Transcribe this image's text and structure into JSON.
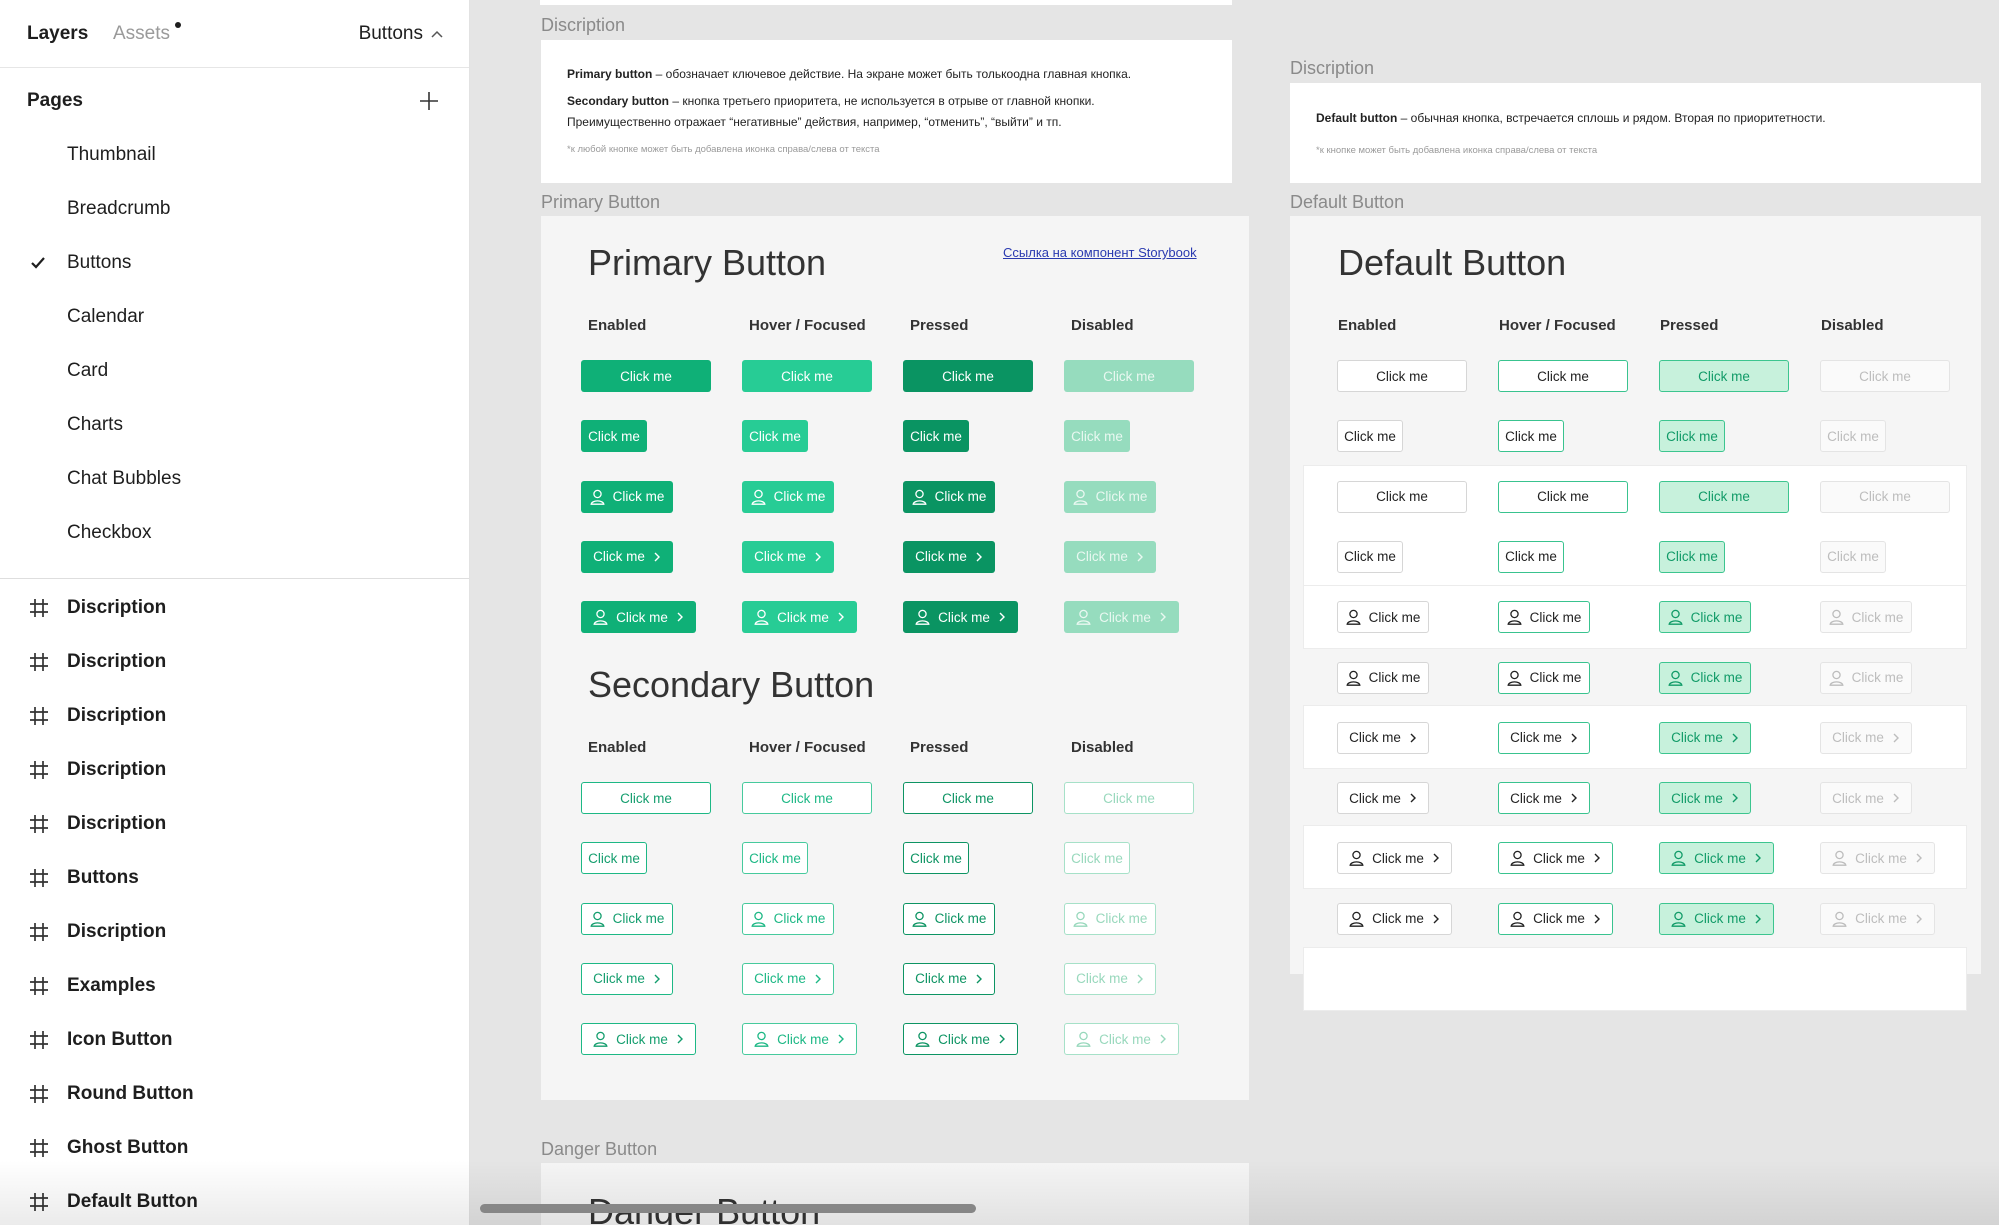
{
  "sidebar": {
    "tabs": {
      "layers": "Layers",
      "assets": "Assets"
    },
    "page_switch": "Buttons",
    "pages_title": "Pages",
    "pages": [
      "Thumbnail",
      "Breadcrumb",
      "Buttons",
      "Calendar",
      "Card",
      "Charts",
      "Chat Bubbles",
      "Checkbox"
    ],
    "active_page": "Buttons",
    "layers": [
      "Discription",
      "Discription",
      "Discription",
      "Discription",
      "Discription",
      "Buttons",
      "Discription",
      "Examples",
      "Icon Button",
      "Round Button",
      "Ghost Button",
      "Default Button"
    ]
  },
  "canvas": {
    "desc_left": {
      "label": "Discription",
      "p1_bold": "Primary button",
      "p1_text": " – обозначает ключевое действие. На экране может быть толькоодна главная кнопка.",
      "p2_bold": "Secondary button",
      "p2_text": " – кнопка третьего приоритета, не используется в отрыве от главной кнопки.",
      "p2_text2": "Преимущественно отражает “негативные” действия, например, “отменить”, “выйти” и тп.",
      "note": "*к любой кнопке может быть добавлена иконка справа/слева от текста"
    },
    "desc_right": {
      "label": "Discription",
      "p1_bold": "Default button",
      "p1_text": " – обычная кнопка, встречается сплошь и рядом. Вторая по приоритетности.",
      "note": "*к кнопке может быть добавлена иконка справа/слева от текста"
    },
    "primary_frame": {
      "label": "Primary Button",
      "title": "Primary Button",
      "link": "Ссылка на компонент Storybook",
      "secondary_title": "Secondary Button"
    },
    "default_frame": {
      "label": "Default Button",
      "title": "Default Button"
    },
    "danger_frame": {
      "label": "Danger Button",
      "title": "Danger Button"
    },
    "column_headers": [
      "Enabled",
      "Hover / Focused",
      "Pressed",
      "Disabled"
    ],
    "button_label": "Click me"
  },
  "colors": {
    "primary_enabled": "#0fb077",
    "primary_hover": "#27cc95",
    "primary_pressed": "#0a9462",
    "primary_disabled": "#96dcbe",
    "default_pressed_bg": "#c7f1dc"
  }
}
